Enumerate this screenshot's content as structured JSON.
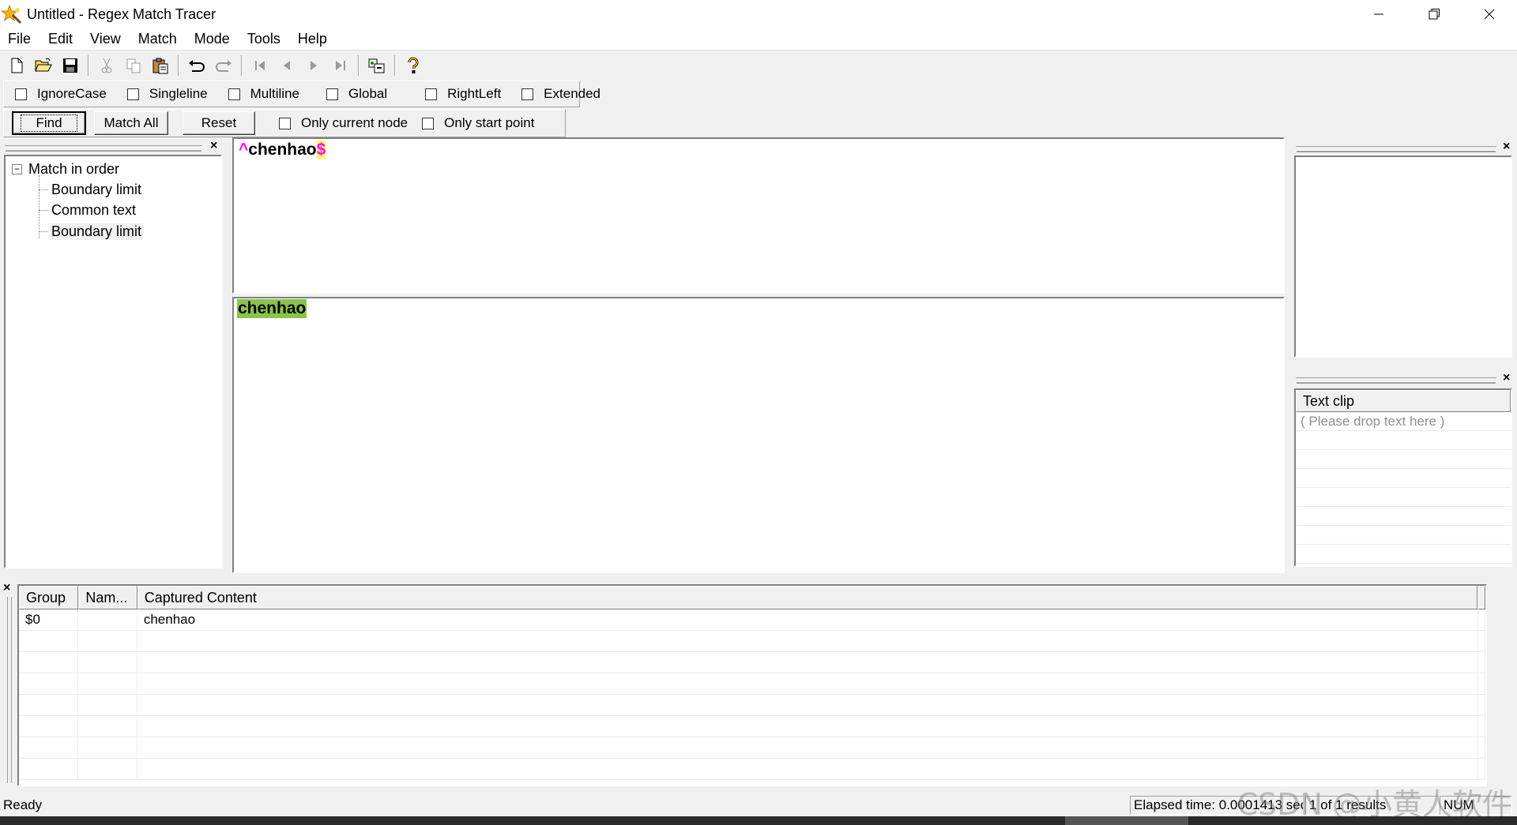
{
  "window": {
    "title": "Untitled - Regex Match Tracer"
  },
  "menu": [
    "File",
    "Edit",
    "View",
    "Match",
    "Mode",
    "Tools",
    "Help"
  ],
  "toolbar": {
    "icons": [
      "new-file-icon",
      "open-folder-icon",
      "save-icon",
      "cut-icon",
      "copy-icon",
      "paste-icon",
      "undo-icon",
      "redo-icon",
      "first-icon",
      "previous-icon",
      "next-icon",
      "last-icon",
      "insert-icon",
      "help-icon"
    ]
  },
  "options": {
    "ignorecase": "IgnoreCase",
    "singleline": "Singleline",
    "multiline": "Multiline",
    "global": "Global",
    "rightleft": "RightLeft",
    "extended": "Extended"
  },
  "actions": {
    "find": "Find",
    "match_all": "Match All",
    "reset": "Reset",
    "only_current_node": "Only current node",
    "only_start_point": "Only start point"
  },
  "tree": {
    "root": "Match in order",
    "children": [
      "Boundary limit",
      "Common text",
      "Boundary limit"
    ]
  },
  "regex": {
    "caret": "^",
    "body": "chenhao",
    "dollar": "$"
  },
  "text": {
    "matched": "chenhao"
  },
  "textclip": {
    "header": "Text clip",
    "placeholder": "( Please drop text here )"
  },
  "results": {
    "headers": [
      "Group",
      "Nam...",
      "Captured Content"
    ],
    "rows": [
      {
        "group": "$0",
        "name": "",
        "content": "chenhao"
      }
    ]
  },
  "status": {
    "ready": "Ready",
    "elapsed": "Elapsed time: 0.0001413 sec",
    "results": "1 of 1 results",
    "num": "NUM"
  },
  "watermark": "CSDN @小黄人软件",
  "colors": {
    "highlight_match": "#8bc34a",
    "regex_anchor": "#ff00ff",
    "regex_anchor_bg": "#ffff60"
  }
}
